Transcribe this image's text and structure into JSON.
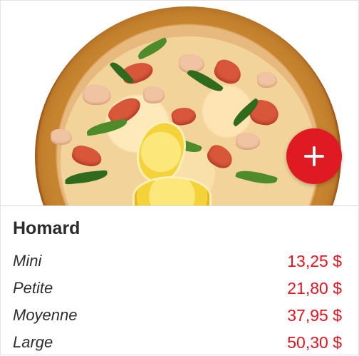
{
  "product": {
    "name": "Homard",
    "image_alt": "pizza-image",
    "add_icon": "plus-icon",
    "sizes": [
      {
        "name": "Mini",
        "price": "13,25 $"
      },
      {
        "name": "Petite",
        "price": "21,80 $"
      },
      {
        "name": "Moyenne",
        "price": "37,95 $"
      },
      {
        "name": "Large",
        "price": "50,30 $"
      }
    ]
  },
  "colors": {
    "accent": "#e01a22",
    "price": "#e3141f",
    "text": "#2b2b2b"
  }
}
